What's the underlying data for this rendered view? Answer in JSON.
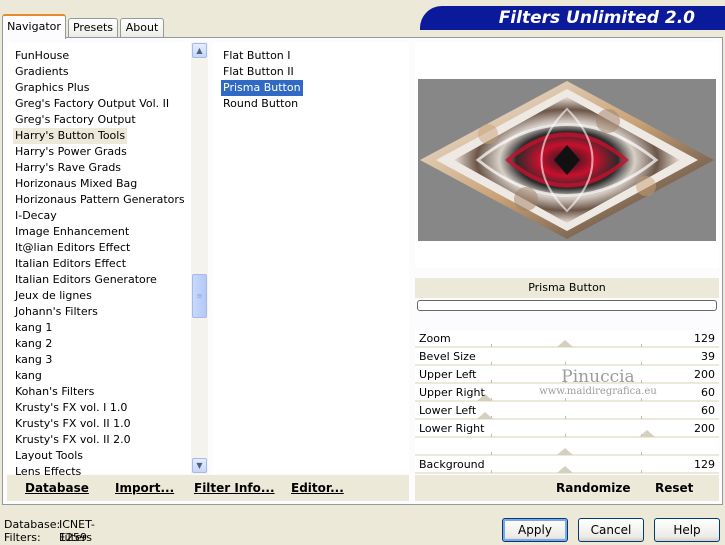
{
  "tabs": [
    "Navigator",
    "Presets",
    "About"
  ],
  "title": "Filters Unlimited 2.0",
  "categories": [
    "FunHouse",
    "Gradients",
    "Graphics Plus",
    "Greg's Factory Output Vol. II",
    "Greg's Factory Output",
    "Harry's Button Tools",
    "Harry's Power Grads",
    "Harry's Rave Grads",
    "Horizonaus Mixed Bag",
    "Horizonaus Pattern Generators",
    "I-Decay",
    "Image Enhancement",
    "It@lian Editors Effect",
    "Italian Editors Effect",
    "Italian Editors Generatore",
    "Jeux de lignes",
    "Johann's Filters",
    "kang 1",
    "kang 2",
    "kang 3",
    "kang",
    "Kohan's Filters",
    "Krusty's FX vol. I 1.0",
    "Krusty's FX vol. II 1.0",
    "Krusty's FX vol. II 2.0",
    "Layout Tools",
    "Lens Effects"
  ],
  "selected_category": "Harry's Button Tools",
  "filters": [
    "Flat Button I",
    "Flat Button II",
    "Prisma Button",
    "Round Button"
  ],
  "selected_filter": "Prisma Button",
  "filter_name": "Prisma Button",
  "params": [
    {
      "label": "Zoom",
      "value": "129"
    },
    {
      "label": "Bevel Size",
      "value": "39"
    },
    {
      "label": "Upper Left",
      "value": "200"
    },
    {
      "label": "Upper Right",
      "value": "60"
    },
    {
      "label": "Lower Left",
      "value": "60"
    },
    {
      "label": "Lower Right",
      "value": "200"
    },
    {
      "label": "",
      "value": ""
    },
    {
      "label": "Background",
      "value": "129"
    }
  ],
  "left_buttons": [
    "Database",
    "Import...",
    "Filter Info...",
    "Editor..."
  ],
  "right_buttons": [
    "Randomize",
    "Reset"
  ],
  "status": {
    "database_label": "Database:",
    "database_value": "ICNET-Filters",
    "filters_label": "Filters:",
    "filters_value": "1259"
  },
  "dialog_buttons": [
    "Apply",
    "Cancel",
    "Help"
  ],
  "watermark": {
    "line1": "Pinuccia",
    "line2": "www.maidiregrafica.eu"
  },
  "colors": {
    "selection": "#316ac5",
    "banner": "#0a1a9a",
    "tab_accent": "#e68b2c"
  }
}
